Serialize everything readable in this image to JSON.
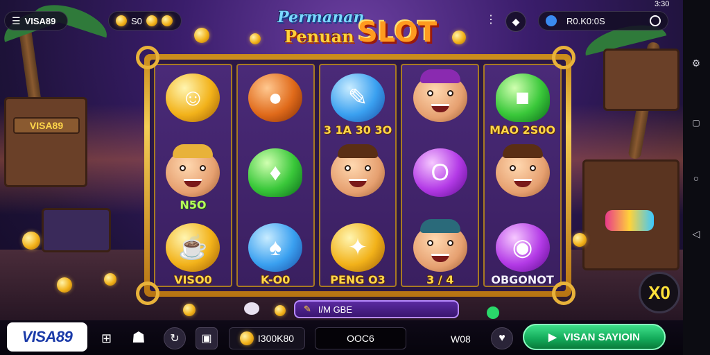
{
  "status_bar": {
    "time": "3:30"
  },
  "header": {
    "menu_icon": "hamburger-menu-icon",
    "brand_label": "VISA89",
    "coin_counter": "S0",
    "logo_line1": "Permanan",
    "logo_line2": "Penuan",
    "logo_line3": "SLOT",
    "balance_text": "R0.K0:0S"
  },
  "reels": [
    {
      "symbols": [
        {
          "art": "gold",
          "glyph": "☺",
          "caption": ""
        },
        {
          "art": "face",
          "hair": "gold",
          "caption": "N5O",
          "caption_style": "green"
        },
        {
          "art": "gold",
          "glyph": "☕",
          "caption": "VISO0",
          "caption_style": "gold"
        }
      ]
    },
    {
      "symbols": [
        {
          "art": "orange",
          "glyph": "●",
          "caption": ""
        },
        {
          "art": "green",
          "glyph": "♦",
          "caption": ""
        },
        {
          "art": "blue",
          "glyph": "♠",
          "caption": "K-O0",
          "caption_style": "gold"
        }
      ]
    },
    {
      "symbols": [
        {
          "art": "blue",
          "glyph": "✎",
          "caption": "3 1A 30 3O",
          "caption_style": "gold"
        },
        {
          "art": "face",
          "hair": "brown",
          "caption": ""
        },
        {
          "art": "gold",
          "glyph": "✦",
          "caption": "PENG O3",
          "caption_style": "gold"
        }
      ]
    },
    {
      "symbols": [
        {
          "art": "face",
          "hair": "purple",
          "caption": ""
        },
        {
          "art": "purple",
          "glyph": "O",
          "caption": ""
        },
        {
          "art": "face",
          "hair": "teal",
          "caption": "3 / 4",
          "caption_style": "gold"
        }
      ]
    },
    {
      "symbols": [
        {
          "art": "green",
          "glyph": "■",
          "caption": "MAO 2S0O",
          "caption_style": "gold"
        },
        {
          "art": "face",
          "hair": "brown",
          "caption": ""
        },
        {
          "art": "purple",
          "glyph": "◉",
          "caption": "OBGONOT",
          "caption_style": "white"
        }
      ]
    }
  ],
  "message_bar": {
    "text": "I/M GBE"
  },
  "bottom_bar": {
    "brand_badge": "VISA89",
    "bet_total": "I300K80",
    "win_display": "OOC6",
    "level_label": "W08",
    "spin_label": "VISAN SAYIOIN",
    "auto_label": "X0"
  },
  "colors": {
    "accent_gold": "#f2b21a",
    "spin_green": "#12a858",
    "frame_purple": "#2b1846"
  }
}
